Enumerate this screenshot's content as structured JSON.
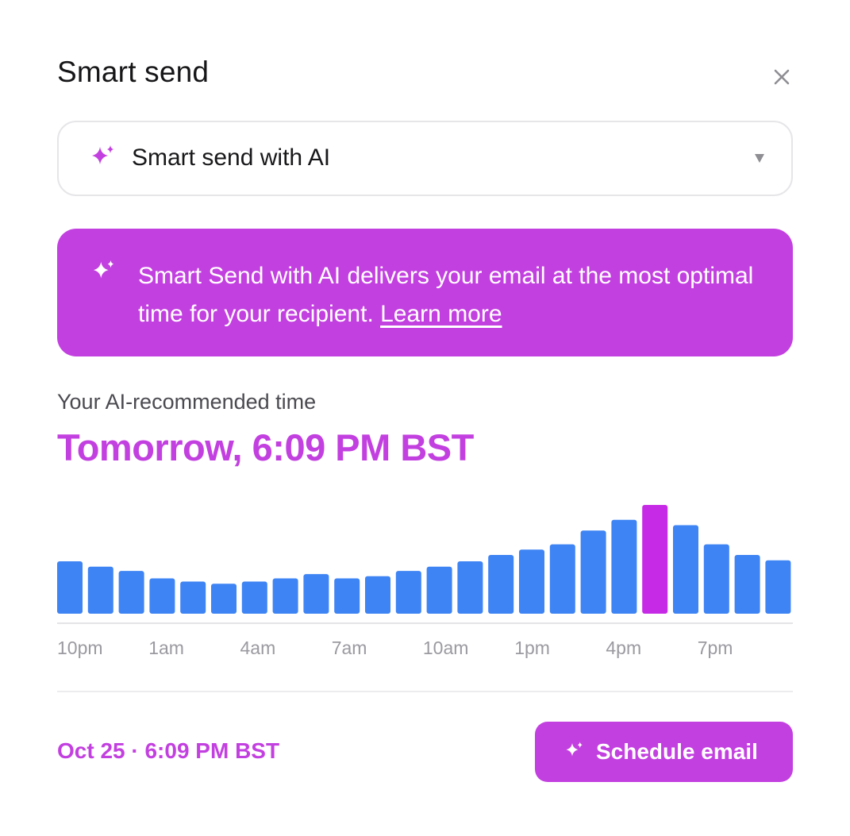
{
  "dialog": {
    "title": "Smart send",
    "close_icon": "close-icon"
  },
  "select": {
    "icon": "sparkle-icon",
    "value": "Smart send with AI",
    "caret_icon": "caret-down-icon"
  },
  "banner": {
    "icon": "sparkle-icon",
    "text": "Smart Send with AI delivers your email at the most optimal time for your recipient. ",
    "link_label": "Learn more"
  },
  "recommendation": {
    "label": "Your AI-recommended time",
    "time": "Tomorrow, 6:09 PM BST"
  },
  "chart_data": {
    "type": "bar",
    "title": "",
    "xlabel": "",
    "ylabel": "",
    "tick_labels": [
      "10pm",
      "1am",
      "4am",
      "7am",
      "10am",
      "1pm",
      "4pm",
      "7pm"
    ],
    "values": [
      47,
      42,
      38,
      31,
      28,
      26,
      28,
      31,
      35,
      31,
      33,
      38,
      42,
      47,
      53,
      58,
      63,
      76,
      86,
      100,
      81,
      63,
      53,
      48
    ],
    "highlight_index": 19,
    "colors": {
      "bar": "#3e84f4",
      "highlight": "#c72ae6"
    },
    "ylim": [
      0,
      100
    ]
  },
  "footer": {
    "date": "Oct 25 · 6:09 PM BST",
    "schedule_icon": "sparkle-icon",
    "schedule_label": "Schedule email"
  },
  "colors": {
    "accent": "#c340e0",
    "bar": "#3e84f4",
    "highlight": "#c72ae6"
  }
}
